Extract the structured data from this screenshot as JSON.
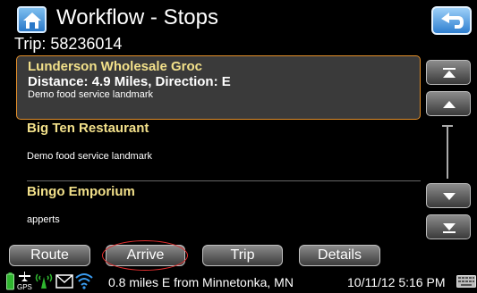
{
  "header": {
    "title": "Workflow - Stops",
    "home_icon": "home-icon",
    "back_icon": "back-arrow-icon"
  },
  "trip": {
    "label": "Trip: 58236014"
  },
  "stops": [
    {
      "name": "Lunderson Wholesale Groc",
      "distance": "Distance: 4.9 Miles, Direction: E",
      "description": "Demo food service landmark",
      "selected": true
    },
    {
      "name": "Big Ten Restaurant",
      "distance": "",
      "description": "Demo food service landmark",
      "selected": false
    },
    {
      "name": "Bingo Emporium",
      "distance": "",
      "description": "apperts",
      "selected": false
    }
  ],
  "scroll_buttons": {
    "top": "scroll-to-top-icon",
    "up": "scroll-up-icon",
    "down": "scroll-down-icon",
    "bottom": "scroll-to-bottom-icon"
  },
  "actions": {
    "route": "Route",
    "arrive": "Arrive",
    "trip": "Trip",
    "details": "Details"
  },
  "status": {
    "location": "0.8 miles E from Minnetonka, MN",
    "datetime": "10/11/12 5:16 PM",
    "gps_label": "GPS"
  },
  "colors": {
    "selected_border": "#e38f2a",
    "stop_name": "#f2e08a",
    "annotation_circle": "#e43030",
    "accent_blue": "#2a78c8"
  }
}
